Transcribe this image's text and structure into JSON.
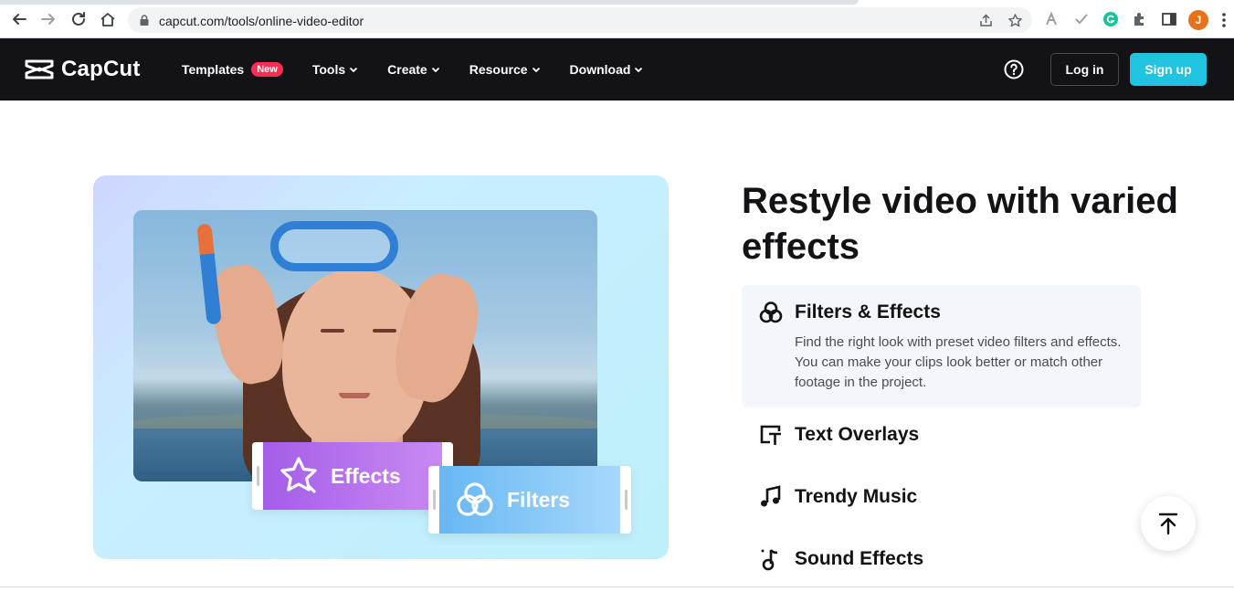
{
  "browser": {
    "url": "capcut.com/tools/online-video-editor",
    "avatar_initial": "J"
  },
  "nav": {
    "logo_text": "CapCut",
    "links": [
      {
        "label": "Templates",
        "badge": "New"
      },
      {
        "label": "Tools"
      },
      {
        "label": "Create"
      },
      {
        "label": "Resource"
      },
      {
        "label": "Download"
      }
    ],
    "login_label": "Log in",
    "signup_label": "Sign up"
  },
  "hero": {
    "chip_effects_label": "Effects",
    "chip_filters_label": "Filters"
  },
  "section": {
    "headline": "Restyle video with varied effects",
    "features": [
      {
        "icon": "filters-effects-icon",
        "title": "Filters & Effects",
        "description": "Find the right look with preset video filters and effects. You can make your clips look better or match other footage in the project.",
        "active": true
      },
      {
        "icon": "text-overlay-icon",
        "title": "Text Overlays",
        "active": false
      },
      {
        "icon": "music-icon",
        "title": "Trendy Music",
        "active": false
      },
      {
        "icon": "sound-effects-icon",
        "title": "Sound Effects",
        "active": false
      }
    ]
  },
  "colors": {
    "nav_bg": "#121217",
    "signup_bg": "#20c3e0",
    "badge_new": "#fe2c55",
    "active_feature_bg": "#f3f6fa"
  }
}
